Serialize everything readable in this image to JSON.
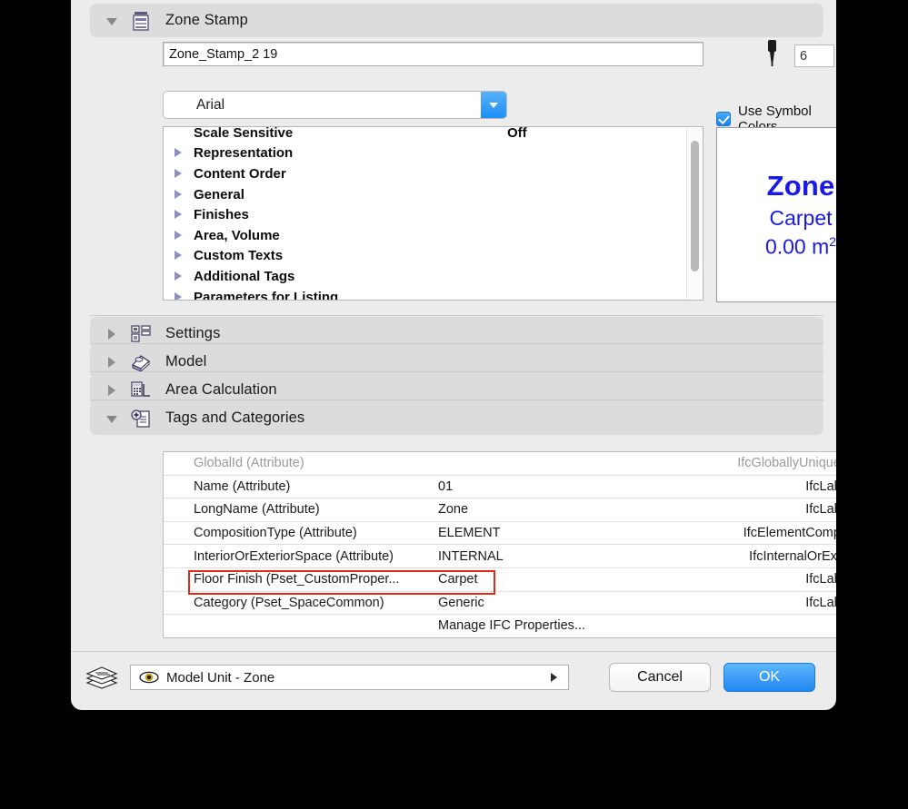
{
  "window": {
    "header": {
      "title": "Zone Stamp",
      "icon": "zone-stamp-icon",
      "expanded": true
    },
    "name_field": {
      "value": "Zone_Stamp_2 19"
    },
    "pen": {
      "icon": "pen-icon",
      "value": "6",
      "swatch_color": "#0b28e8",
      "swatch_name": "line-weight-swatch"
    },
    "font": {
      "selected": "Arial",
      "options": [
        "Arial"
      ]
    },
    "use_symbol_colors": {
      "label": "Use Symbol Colors",
      "checked": true
    },
    "tree": {
      "rows": [
        {
          "label": "Scale Sensitive",
          "value": "Off",
          "has_twisty": false,
          "clipped": "top"
        },
        {
          "label": "Representation",
          "value": "",
          "has_twisty": true
        },
        {
          "label": "Content Order",
          "value": "",
          "has_twisty": true
        },
        {
          "label": "General",
          "value": "",
          "has_twisty": true
        },
        {
          "label": "Finishes",
          "value": "",
          "has_twisty": true
        },
        {
          "label": "Area, Volume",
          "value": "",
          "has_twisty": true
        },
        {
          "label": "Custom Texts",
          "value": "",
          "has_twisty": true
        },
        {
          "label": "Additional Tags",
          "value": "",
          "has_twisty": true
        },
        {
          "label": "Parameters for Listing",
          "value": "",
          "has_twisty": true,
          "clipped": "bottom"
        }
      ]
    },
    "preview": {
      "zone_label": "Zone",
      "material": "Carpet",
      "area_value": "0.00 m",
      "area_exponent": "2",
      "text_color": "#1919e8"
    },
    "sections": [
      {
        "label": "Settings",
        "icon": "settings-icon",
        "expanded": false
      },
      {
        "label": "Model",
        "icon": "model-icon",
        "expanded": false
      },
      {
        "label": "Area Calculation",
        "icon": "area-calculation-icon",
        "expanded": false
      },
      {
        "label": "Tags and Categories",
        "icon": "tags-and-categories-icon",
        "expanded": true
      }
    ],
    "ifc_table": {
      "rows": [
        {
          "name": "GlobalId (Attribute)",
          "value": "",
          "type": "IfcGloballyUniqueId",
          "dim": true,
          "highlighted": false
        },
        {
          "name": "Name (Attribute)",
          "value": "01",
          "type": "IfcLabel",
          "dim": false,
          "highlighted": false
        },
        {
          "name": "LongName (Attribute)",
          "value": "Zone",
          "type": "IfcLabel",
          "dim": false,
          "highlighted": false
        },
        {
          "name": "CompositionType (Attribute)",
          "value": "ELEMENT",
          "type": "IfcElementComp...",
          "dim": false,
          "highlighted": false
        },
        {
          "name": "InteriorOrExteriorSpace (Attribute)",
          "value": "INTERNAL",
          "type": "IfcInternalOrExt...",
          "dim": false,
          "highlighted": false
        },
        {
          "name": "Floor Finish (Pset_CustomProper...",
          "value": "Carpet",
          "type": "IfcLabel",
          "dim": false,
          "highlighted": true
        },
        {
          "name": "Category (Pset_SpaceCommon)",
          "value": "Generic",
          "type": "IfcLabel",
          "dim": false,
          "highlighted": false
        },
        {
          "name": "",
          "value": "Manage IFC Properties...",
          "type": "",
          "dim": false,
          "highlighted": false
        }
      ],
      "highlight_color": "#e02b18"
    },
    "footer": {
      "stack_icon": "layer-stack-icon",
      "unit_popup": {
        "icon": "eye-icon",
        "label": "Model Unit - Zone"
      },
      "cancel_label": "Cancel",
      "ok_label": "OK",
      "ok_color": "#2287f1"
    }
  }
}
